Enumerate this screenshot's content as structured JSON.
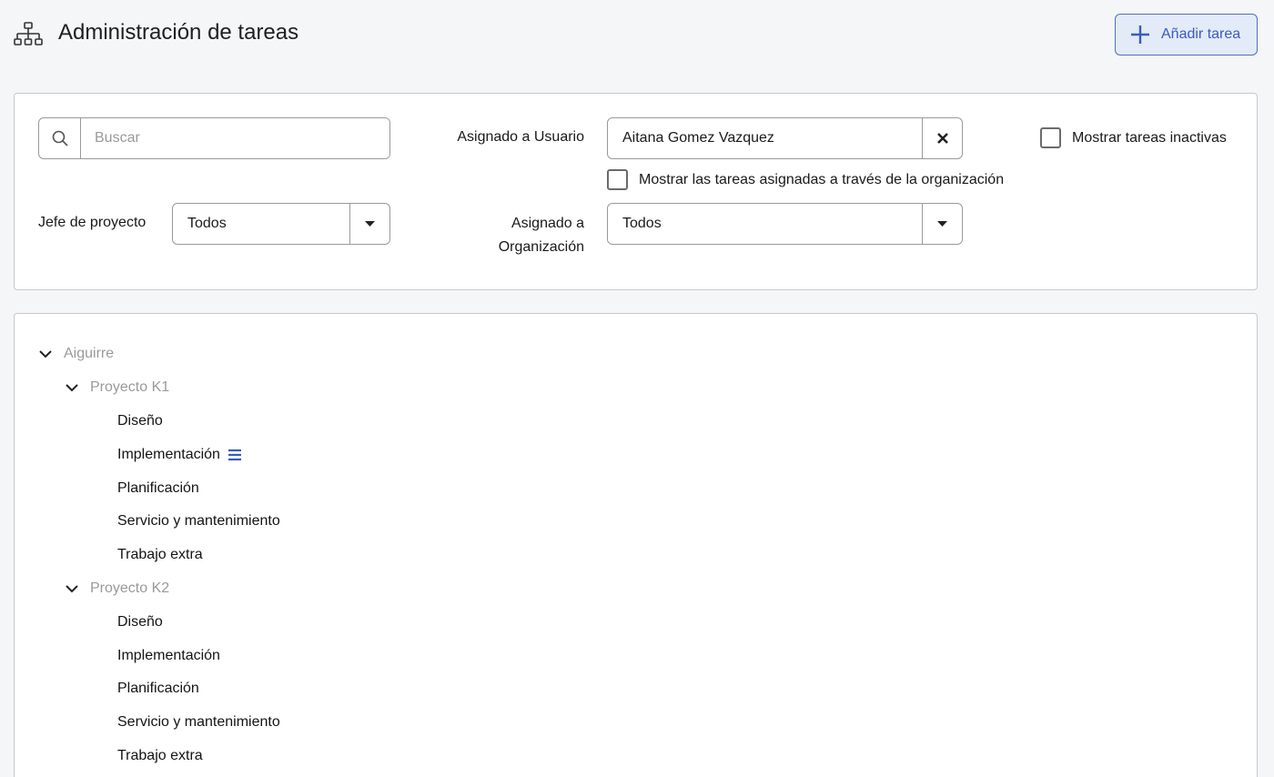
{
  "header": {
    "title": "Administración de tareas",
    "add_button_label": "Añadir tarea"
  },
  "filters": {
    "search_placeholder": "Buscar",
    "search_value": "",
    "assigned_user_label": "Asignado a Usuario",
    "assigned_user_value": "Aitana Gomez Vazquez",
    "show_inactive_label": "Mostrar tareas inactivas",
    "show_inactive_checked": false,
    "show_org_tasks_label": "Mostrar las tareas asignadas a través de la organización",
    "show_org_tasks_checked": false,
    "project_manager_label": "Jefe de proyecto",
    "project_manager_value": "Todos",
    "assigned_org_label_line1": "Asignado a",
    "assigned_org_label_line2": "Organización",
    "assigned_org_value": "Todos"
  },
  "tree": {
    "root": "Aiguirre",
    "projects": [
      {
        "name": "Proyecto K1",
        "tasks": [
          "Diseño",
          "Implementación",
          "Planificación",
          "Servicio y mantenimiento",
          "Trabajo extra"
        ]
      },
      {
        "name": "Proyecto K2",
        "tasks": [
          "Diseño",
          "Implementación",
          "Planificación",
          "Servicio y mantenimiento",
          "Trabajo extra"
        ]
      }
    ]
  },
  "icons": {
    "org": "org-chart-icon",
    "add": "plus-icon",
    "search": "search-icon",
    "clear": "close-icon",
    "dropdown": "caret-down-icon",
    "expand": "chevron-down-icon",
    "menu": "menu-lines-icon"
  },
  "colors": {
    "accent": "#3a5bbf",
    "accent_bg": "#e3eaf8",
    "muted_text": "#9a9a9a"
  }
}
